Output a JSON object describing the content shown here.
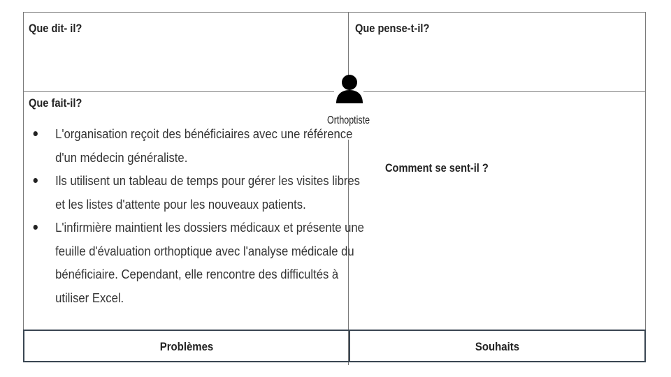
{
  "says": {
    "title": "Que dit- il?"
  },
  "thinks": {
    "title": "Que pense-t-il?"
  },
  "does": {
    "title": "Que fait-il?",
    "items": [
      "L'organisation reçoit des bénéficiaires avec une référence d'un médecin généraliste.",
      "Ils utilisent un tableau de temps pour gérer les visites libres et les listes d'attente pour les nouveaux patients.",
      "L'infirmière maintient les dossiers médicaux et présente une feuille d'évaluation orthoptique avec l'analyse médicale du bénéficiaire. Cependant, elle rencontre des difficultés à utiliser Excel."
    ]
  },
  "feels": {
    "title": "Comment se sent-il ?"
  },
  "persona": {
    "label": "Orthoptiste",
    "icon": "person-icon"
  },
  "pains": {
    "title": "Problèmes"
  },
  "gains": {
    "title": "Souhaits"
  }
}
